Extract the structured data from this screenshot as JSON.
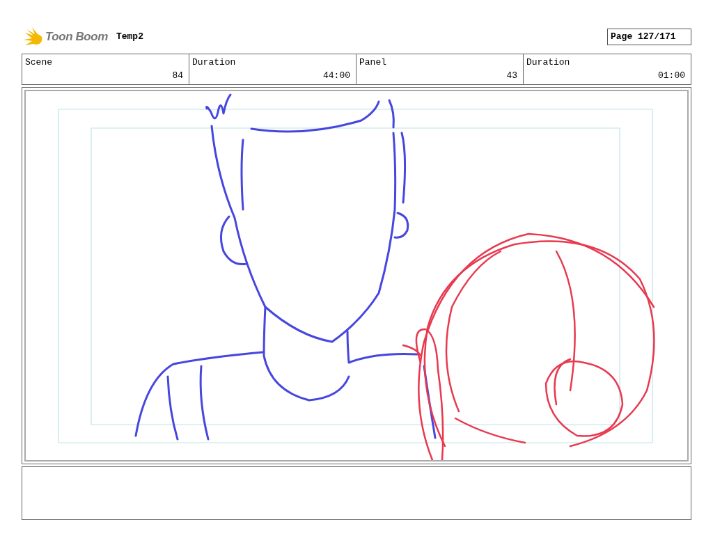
{
  "header": {
    "logo_text": "Toon Boom",
    "project": "Temp2",
    "page": "Page 127/171"
  },
  "fields": [
    {
      "label": "Scene",
      "value": "84"
    },
    {
      "label": "Duration",
      "value": "44:00"
    },
    {
      "label": "Panel",
      "value": "43"
    },
    {
      "label": "Duration",
      "value": "01:00"
    }
  ]
}
